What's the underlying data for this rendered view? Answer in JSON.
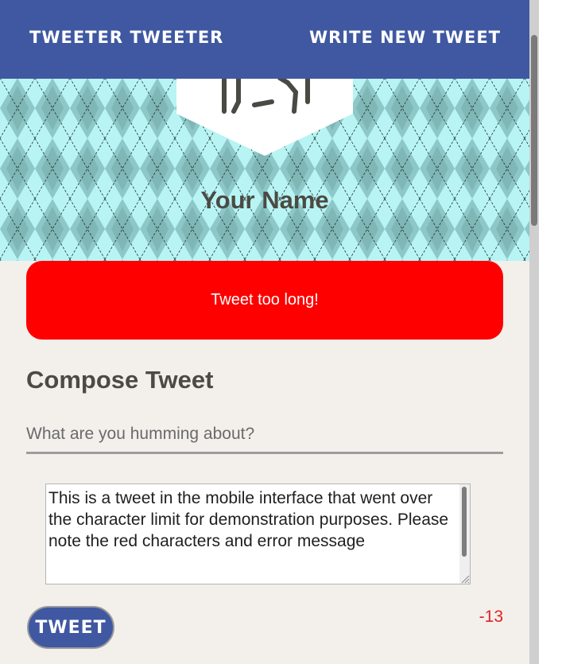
{
  "header": {
    "brand": "TWEETER TWEETER",
    "write_new": "WRITE NEW TWEET"
  },
  "profile": {
    "name": "Your Name"
  },
  "error": {
    "message": "Tweet too long!"
  },
  "compose": {
    "title": "Compose Tweet",
    "placeholder": "What are you humming about?",
    "textarea_value": "This is a tweet in the mobile interface that went over the character limit for demonstration purposes. Please note the red characters and error message",
    "button_label": "TWEET",
    "counter": "-13"
  },
  "colors": {
    "header_bg": "#3f58a1",
    "error_bg": "#ff0000",
    "counter_text": "#e12222",
    "page_bg": "#f3f0ec"
  }
}
